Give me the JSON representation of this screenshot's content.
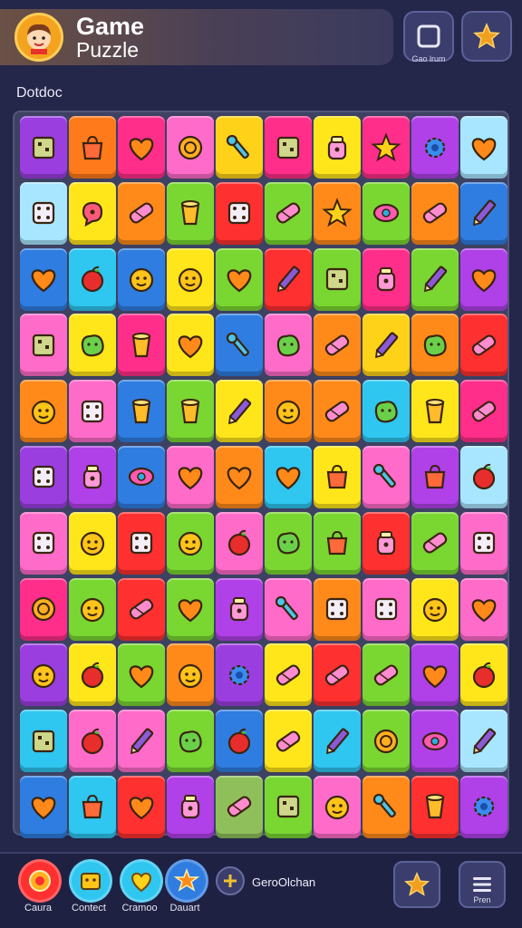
{
  "header": {
    "title": "Game",
    "subtitle": "Puzzle",
    "button_caption": "Gao lrum"
  },
  "section_label": "Dotdoc",
  "board": {
    "rows": [
      [
        [
          "#9b3ee0",
          "box"
        ],
        [
          "#ff7a1a",
          "bag"
        ],
        [
          "#ff2e8a",
          "heart"
        ],
        [
          "#ff6bc9",
          "coin"
        ],
        [
          "#ffd21a",
          "wrench"
        ],
        [
          "#ff2e8a",
          "cake"
        ],
        [
          "#ffe61a",
          "jar"
        ],
        [
          "#ff2e8a",
          "star"
        ],
        [
          "#b040e8",
          "gear"
        ],
        [
          "#a8e6ff",
          "heart"
        ]
      ],
      [
        [
          "#a8e6ff",
          "dice"
        ],
        [
          "#ffe61a",
          "bubble"
        ],
        [
          "#ff8a1a",
          "candy"
        ],
        [
          "#7ad631",
          "cup"
        ],
        [
          "#ff3030",
          "dice"
        ],
        [
          "#7ad631",
          "candy"
        ],
        [
          "#ff8a1a",
          "star"
        ],
        [
          "#7ad631",
          "eye"
        ],
        [
          "#ff8a1a",
          "candy"
        ],
        [
          "#2f7de0",
          "pencil"
        ]
      ],
      [
        [
          "#2f7de0",
          "heart"
        ],
        [
          "#2fc6f0",
          "apple"
        ],
        [
          "#2f7de0",
          "face"
        ],
        [
          "#ffe61a",
          "face"
        ],
        [
          "#7ad631",
          "heart"
        ],
        [
          "#ff3030",
          "pencil"
        ],
        [
          "#7ad631",
          "box"
        ],
        [
          "#ff2e8a",
          "jar"
        ],
        [
          "#7ad631",
          "pencil"
        ],
        [
          "#b040e8",
          "heart"
        ]
      ],
      [
        [
          "#ff6bc9",
          "box"
        ],
        [
          "#ffe61a",
          "blob"
        ],
        [
          "#ff2e8a",
          "cup"
        ],
        [
          "#ffe61a",
          "heart"
        ],
        [
          "#2f7de0",
          "wrench"
        ],
        [
          "#ff6bc9",
          "blob"
        ],
        [
          "#ff8a1a",
          "candy"
        ],
        [
          "#ffd21a",
          "pencil"
        ],
        [
          "#ff8a1a",
          "blob"
        ],
        [
          "#ff3030",
          "candy"
        ]
      ],
      [
        [
          "#ff8a1a",
          "face"
        ],
        [
          "#ff6bc9",
          "dice"
        ],
        [
          "#2f7de0",
          "cup"
        ],
        [
          "#7ad631",
          "cup"
        ],
        [
          "#ffe61a",
          "pencil"
        ],
        [
          "#ff8a1a",
          "face"
        ],
        [
          "#ff8a1a",
          "candy"
        ],
        [
          "#2fc6f0",
          "blob"
        ],
        [
          "#ffe61a",
          "cup"
        ],
        [
          "#ff2e8a",
          "candy"
        ]
      ],
      [
        [
          "#9b3ee0",
          "dice"
        ],
        [
          "#b040e8",
          "jar"
        ],
        [
          "#2f7de0",
          "eye"
        ],
        [
          "#ff6bc9",
          "heart"
        ],
        [
          "#ff8a1a",
          "heart"
        ],
        [
          "#2fc6f0",
          "heart"
        ],
        [
          "#ffe61a",
          "bag"
        ],
        [
          "#ff6bc9",
          "wrench"
        ],
        [
          "#b040e8",
          "bag"
        ],
        [
          "#a8e6ff",
          "apple"
        ]
      ],
      [
        [
          "#ff6bc9",
          "dice"
        ],
        [
          "#ffe61a",
          "face"
        ],
        [
          "#ff3030",
          "dice"
        ],
        [
          "#7ad631",
          "face"
        ],
        [
          "#ff6bc9",
          "apple"
        ],
        [
          "#7ad631",
          "blob"
        ],
        [
          "#7ad631",
          "bag"
        ],
        [
          "#ff3030",
          "jar"
        ],
        [
          "#7ad631",
          "candy"
        ],
        [
          "#ff6bc9",
          "dice"
        ]
      ],
      [
        [
          "#ff2e8a",
          "coin"
        ],
        [
          "#7ad631",
          "face"
        ],
        [
          "#ff3030",
          "candy"
        ],
        [
          "#7ad631",
          "heart"
        ],
        [
          "#b040e8",
          "jar"
        ],
        [
          "#ff6bc9",
          "wrench"
        ],
        [
          "#ff8a1a",
          "dice"
        ],
        [
          "#ff6bc9",
          "dice"
        ],
        [
          "#ffe61a",
          "face"
        ],
        [
          "#ff6bc9",
          "heart"
        ]
      ],
      [
        [
          "#9b3ee0",
          "face"
        ],
        [
          "#ffe61a",
          "apple"
        ],
        [
          "#7ad631",
          "heart"
        ],
        [
          "#ff8a1a",
          "face"
        ],
        [
          "#9b3ee0",
          "gear"
        ],
        [
          "#ffe61a",
          "candy"
        ],
        [
          "#ff3030",
          "candy"
        ],
        [
          "#7ad631",
          "candy"
        ],
        [
          "#b040e8",
          "heart"
        ],
        [
          "#ffe61a",
          "apple"
        ]
      ],
      [
        [
          "#2fc6f0",
          "box"
        ],
        [
          "#ff6bc9",
          "apple"
        ],
        [
          "#ff6bc9",
          "pencil"
        ],
        [
          "#7ad631",
          "blob"
        ],
        [
          "#2f7de0",
          "apple"
        ],
        [
          "#ffe61a",
          "candy"
        ],
        [
          "#2fc6f0",
          "pencil"
        ],
        [
          "#7ad631",
          "coin"
        ],
        [
          "#b040e8",
          "eye"
        ],
        [
          "#a8e6ff",
          "pencil"
        ]
      ],
      [
        [
          "#2f7de0",
          "heart"
        ],
        [
          "#2fc6f0",
          "bag"
        ],
        [
          "#ff3030",
          "heart"
        ],
        [
          "#b040e8",
          "jar"
        ],
        [
          "#8fbf5a",
          "candy"
        ],
        [
          "#7ad631",
          "box"
        ],
        [
          "#ff6bc9",
          "face"
        ],
        [
          "#ff8a1a",
          "wrench"
        ],
        [
          "#ff3030",
          "cup"
        ],
        [
          "#b040e8",
          "gear"
        ]
      ]
    ]
  },
  "bottom_bar": {
    "buttons": [
      {
        "label": "Caura",
        "color": "#ff3030",
        "icon": "coin-icon"
      },
      {
        "label": "Contect",
        "color": "#2fc6f0",
        "icon": "box-icon"
      },
      {
        "label": "Cramoo",
        "color": "#2fc6f0",
        "icon": "heart-icon"
      },
      {
        "label": "Dauart",
        "color": "#2f7de0",
        "icon": "star-icon"
      }
    ],
    "mini_text": "GeroOlchan",
    "menu_caption": "Pren"
  }
}
